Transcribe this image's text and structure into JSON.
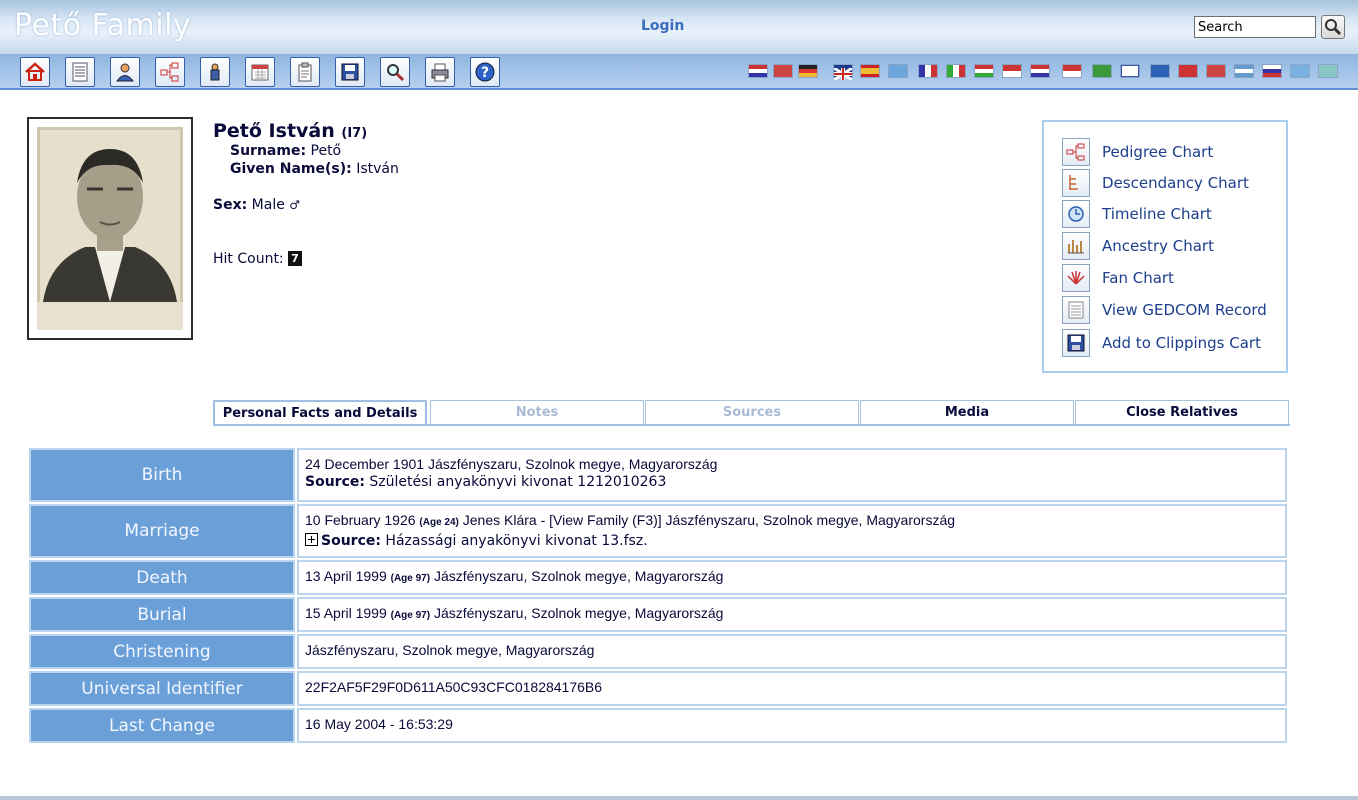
{
  "header": {
    "site_title": "Pető Family",
    "login_label": "Login",
    "search_value": "Search"
  },
  "toolbar": {
    "icons": [
      "home-icon",
      "list-icon",
      "person-icon",
      "pedigree-icon",
      "individual-icon",
      "calendar-icon",
      "clipboard-icon",
      "save-icon",
      "search-icon",
      "print-icon",
      "help-icon"
    ],
    "flag_count": 23
  },
  "person": {
    "name": "Pető István",
    "id": "(I7)",
    "surname_label": "Surname:",
    "surname": "Pető",
    "given_label": "Given Name(s):",
    "given": "István",
    "sex_label": "Sex:",
    "sex": "Male",
    "sex_symbol": "♂",
    "hit_label": "Hit Count:",
    "hit_count": "7"
  },
  "chart_links": [
    {
      "label": "Pedigree Chart",
      "icon": "pedigree-chart-icon"
    },
    {
      "label": "Descendancy Chart",
      "icon": "descendancy-chart-icon"
    },
    {
      "label": "Timeline Chart",
      "icon": "timeline-chart-icon"
    },
    {
      "label": "Ancestry Chart",
      "icon": "ancestry-chart-icon"
    },
    {
      "label": "Fan Chart",
      "icon": "fan-chart-icon"
    },
    {
      "label": "View GEDCOM Record",
      "icon": "gedcom-record-icon"
    },
    {
      "label": "Add to Clippings Cart",
      "icon": "clippings-cart-icon"
    }
  ],
  "tabs": [
    {
      "label": "Personal Facts and Details",
      "state": "active"
    },
    {
      "label": "Notes",
      "state": "dim"
    },
    {
      "label": "Sources",
      "state": "dim"
    },
    {
      "label": "Media",
      "state": "normal"
    },
    {
      "label": "Close Relatives",
      "state": "normal"
    }
  ],
  "facts": {
    "birth": {
      "label": "Birth",
      "text": "24 December 1901 Jászfényszaru, Szolnok megye, Magyarország",
      "source_label": "Source:",
      "source": "Születési anyakönyvi kivonat 1212010263"
    },
    "marriage": {
      "label": "Marriage",
      "date": "10 February 1926",
      "age": "(Age 24)",
      "rest": "Jenes Klára - [View Family (F3)] Jászfényszaru, Szolnok megye, Magyarország",
      "source_label": "Source:",
      "source": "Házassági anyakönyvi kivonat 13.fsz."
    },
    "death": {
      "label": "Death",
      "date": "13 April 1999",
      "age": "(Age 97)",
      "place": "Jászfényszaru, Szolnok megye, Magyarország"
    },
    "burial": {
      "label": "Burial",
      "date": "15 April 1999",
      "age": "(Age 97)",
      "place": "Jászfényszaru, Szolnok megye, Magyarország"
    },
    "christening": {
      "label": "Christening",
      "text": "Jászfényszaru, Szolnok megye, Magyarország"
    },
    "uid": {
      "label": "Universal Identifier",
      "text": "22F2AF5F29F0D611A50C93CFC018284176B6"
    },
    "last_change": {
      "label": "Last Change",
      "text": "16 May 2004 - 16:53:29"
    }
  }
}
